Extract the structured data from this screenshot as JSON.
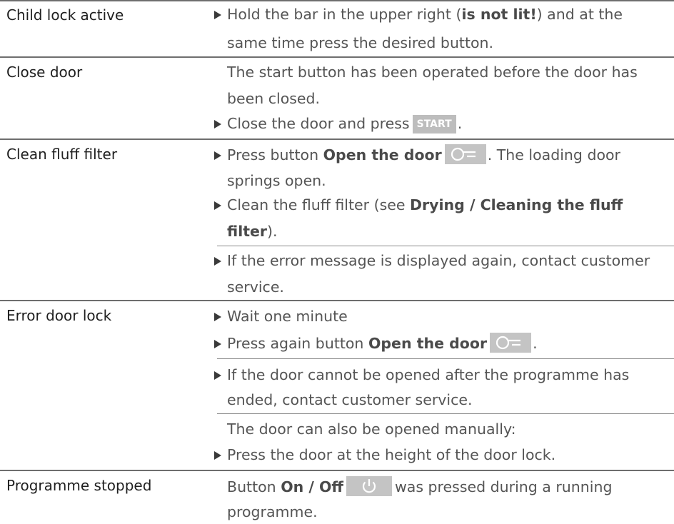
{
  "rows": [
    {
      "label": "Child lock active",
      "lines": [
        {
          "pre": "Hold the bar in the upper right (",
          "bold": "is not lit!",
          "post": ") and at the"
        },
        {
          "text": "same time press the desired button."
        }
      ]
    },
    {
      "label": "Close door",
      "lines": [
        {
          "text": "The start button has been operated before the door has"
        },
        {
          "text": "been closed."
        },
        {
          "pre": "Close the door and press",
          "key": "START",
          "post": "."
        }
      ]
    },
    {
      "label": "Clean fluff filter",
      "lines": [
        {
          "pre": "Press button ",
          "bold": "Open the door",
          "post": ". The loading door"
        },
        {
          "text": "springs open."
        },
        {
          "pre": "Clean the fluff filter (see ",
          "bold": "Drying / Cleaning the fluff"
        },
        {
          "bold": "filter",
          "post": ")."
        },
        {
          "text": "If the error message is displayed again, contact customer"
        },
        {
          "text": "service."
        }
      ]
    },
    {
      "label": "Error door lock",
      "lines": [
        {
          "text": "Wait one minute"
        },
        {
          "pre": "Press again button ",
          "bold": "Open the door",
          "post": "."
        },
        {
          "text": "If the door cannot be opened after the programme has"
        },
        {
          "text": "ended, contact customer service."
        },
        {
          "text": "The door can also be opened manually:"
        },
        {
          "text": "Press the door at the height of the door lock."
        }
      ]
    },
    {
      "label": "Programme stopped",
      "lines": [
        {
          "pre": "Button ",
          "bold": "On / Off",
          "post": "was pressed during a running"
        },
        {
          "text": "programme."
        }
      ]
    }
  ]
}
